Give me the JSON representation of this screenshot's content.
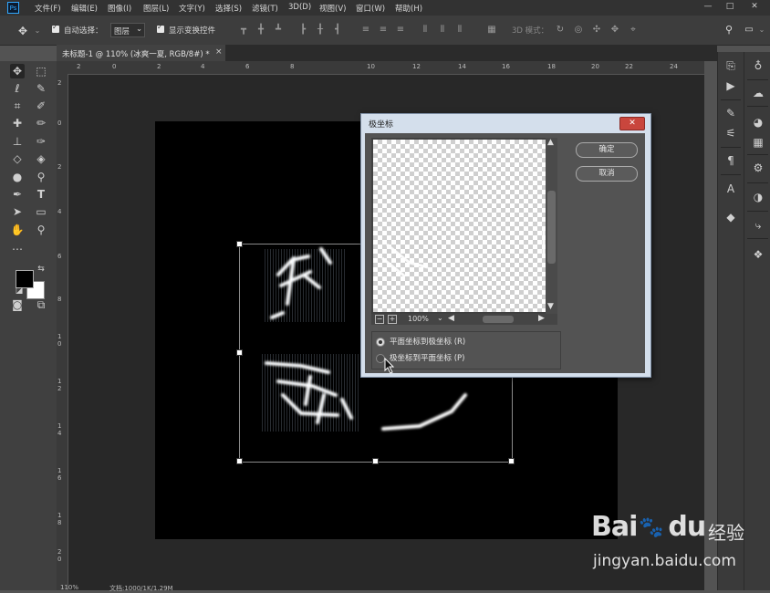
{
  "app": {
    "logo": "Ps"
  },
  "menu": [
    "文件(F)",
    "编辑(E)",
    "图像(I)",
    "图层(L)",
    "文字(Y)",
    "选择(S)",
    "滤镜(T)",
    "3D(D)",
    "视图(V)",
    "窗口(W)",
    "帮助(H)"
  ],
  "window_controls": {
    "minimize": "—",
    "restore": "□",
    "close": "✕"
  },
  "options": {
    "auto_select_label": "自动选择：",
    "auto_select_value": "图层",
    "show_transform_label": "显示变换控件",
    "mode_3d_label": "3D 模式："
  },
  "tab": {
    "title": "未标题-1 @ 110% (冰爽一夏, RGB/8#) *",
    "close": "×"
  },
  "ruler_top_ticks": [
    "2",
    "0",
    "2",
    "4",
    "6",
    "8",
    "10",
    "12",
    "14",
    "16",
    "18",
    "20",
    "22",
    "24"
  ],
  "ruler_left_ticks": [
    "2",
    "0",
    "2",
    "4",
    "6",
    "8",
    "1 0",
    "1 2",
    "1 4",
    "1 6",
    "1 8",
    "2 0"
  ],
  "dialog": {
    "title": "极坐标",
    "ok_label": "确定",
    "cancel_label": "取消",
    "zoom": "100%",
    "options": [
      {
        "label": "平面坐标到极坐标 (R)",
        "selected": true
      },
      {
        "label": "极坐标到平面坐标 (P)",
        "selected": false
      }
    ]
  },
  "status": {
    "zoom": "110%",
    "doc": "文档:1000/1K/1.29M"
  },
  "watermark": {
    "brand": "Bai",
    "brand2": "du",
    "tail": "经验",
    "url": "jingyan.baidu.com"
  },
  "colors": {
    "accent": "#31a8ff",
    "foreground": "#000000",
    "background": "#ffffff"
  }
}
